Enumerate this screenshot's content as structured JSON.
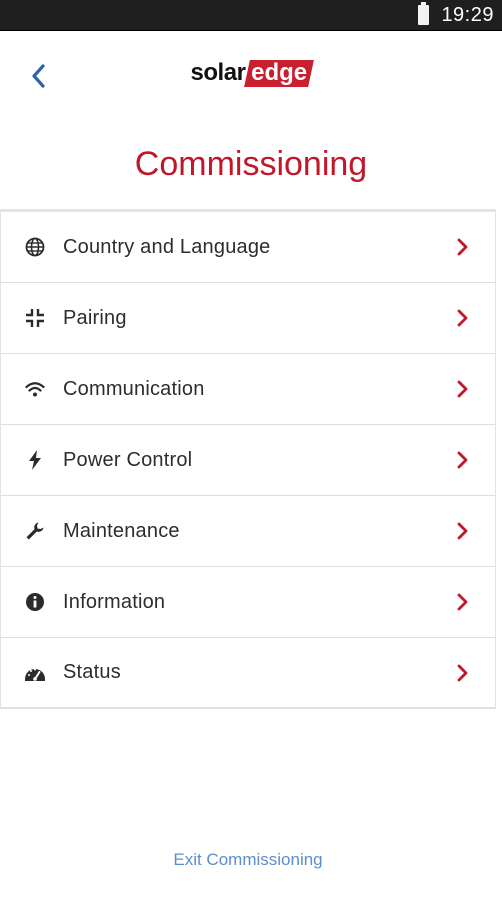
{
  "status_bar": {
    "time": "19:29"
  },
  "header": {
    "logo": {
      "part1": "solar",
      "part2": "edge"
    }
  },
  "title": "Commissioning",
  "menu": [
    {
      "label": "Country and Language",
      "icon": "globe-icon"
    },
    {
      "label": "Pairing",
      "icon": "pairing-icon"
    },
    {
      "label": "Communication",
      "icon": "wifi-icon"
    },
    {
      "label": "Power Control",
      "icon": "bolt-icon"
    },
    {
      "label": "Maintenance",
      "icon": "wrench-icon"
    },
    {
      "label": "Information",
      "icon": "info-icon"
    },
    {
      "label": "Status",
      "icon": "gauge-icon"
    }
  ],
  "footer": {
    "exit_label": "Exit Commissioning"
  },
  "colors": {
    "brand_red": "#c0172b",
    "link_blue": "#5b8fcc",
    "back_blue": "#2f63b0"
  }
}
